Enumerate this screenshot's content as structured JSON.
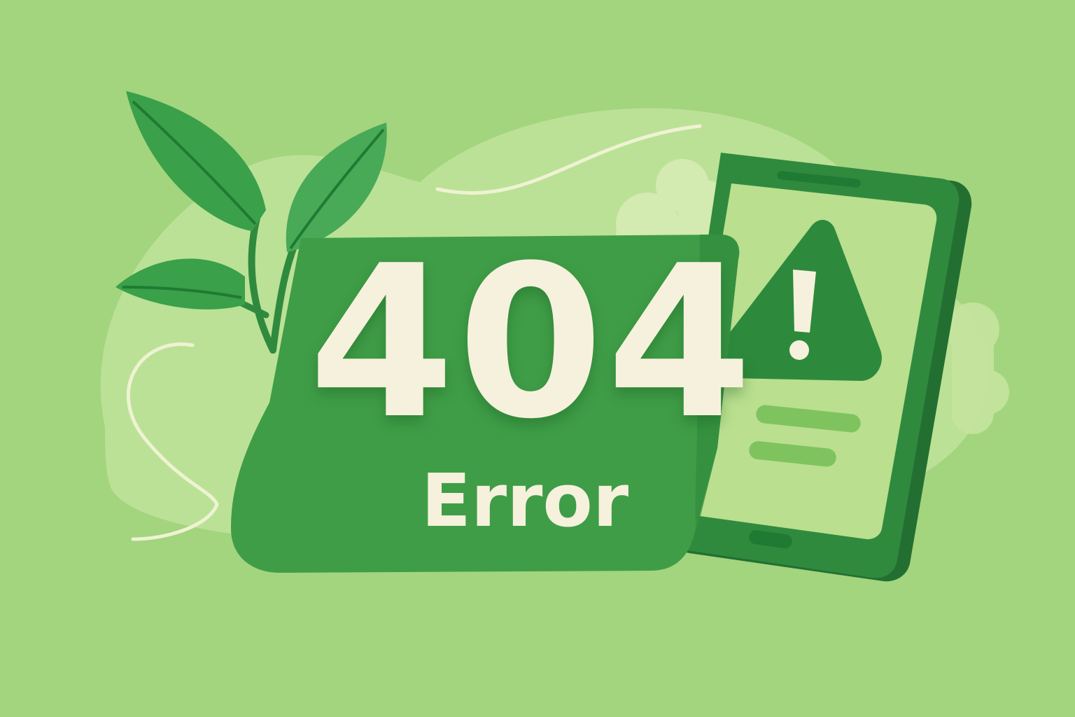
{
  "error": {
    "code": "404",
    "label": "Error"
  },
  "colors": {
    "background": "#a3d47e",
    "blob": "#bfe39a",
    "card": "#3f9d47",
    "card_dark": "#2e8a3a",
    "device_frame": "#2f8a3e",
    "device_screen": "#b9df8f",
    "warning_triangle": "#2d8a3c",
    "text": "#f6f1dc",
    "leaf": "#3aa04a"
  },
  "icons": [
    "plant-leaves-icon",
    "tablet-icon",
    "warning-triangle-icon",
    "cloud-icon"
  ]
}
